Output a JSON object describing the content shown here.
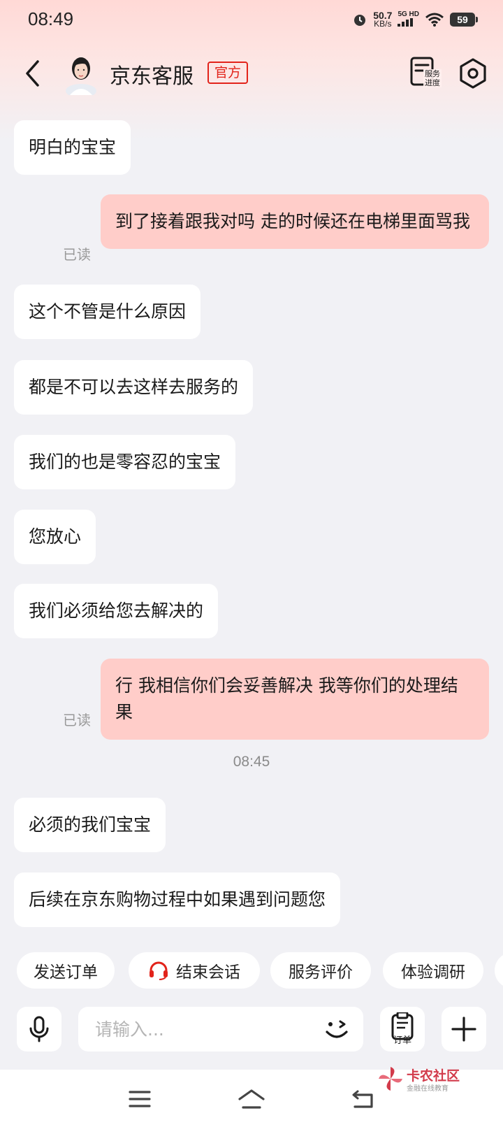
{
  "status_bar": {
    "time": "08:49",
    "net_speed_value": "50.7",
    "net_speed_unit": "KB/s",
    "network_type": "5G HD",
    "battery": "59"
  },
  "header": {
    "title": "京东客服",
    "badge": "官方",
    "service_progress_label": "服务进度"
  },
  "messages": [
    {
      "side": "left",
      "text": "明白的宝宝"
    },
    {
      "side": "right",
      "text": "到了接着跟我对吗 走的时候还在电梯里面骂我",
      "status": "已读"
    },
    {
      "side": "left",
      "text": "这个不管是什么原因"
    },
    {
      "side": "left",
      "text": "都是不可以去这样去服务的"
    },
    {
      "side": "left",
      "text": "我们的也是零容忍的宝宝"
    },
    {
      "side": "left",
      "text": "您放心"
    },
    {
      "side": "left",
      "text": "我们必须给您去解决的"
    },
    {
      "side": "right",
      "text": "行 我相信你们会妥善解决 我等你们的处理结果",
      "status": "已读"
    },
    {
      "side": "time",
      "text": "08:45"
    },
    {
      "side": "left",
      "text": "必须的我们宝宝"
    },
    {
      "side": "left",
      "text": "后续在京东购物过程中如果遇到问题您"
    }
  ],
  "quick_actions": [
    {
      "label": "发送订单",
      "icon": null
    },
    {
      "label": "结束会话",
      "icon": "headset-icon"
    },
    {
      "label": "服务评价",
      "icon": null
    },
    {
      "label": "体验调研",
      "icon": null
    }
  ],
  "input": {
    "placeholder": "请输入...",
    "order_label": "订单"
  },
  "watermark": {
    "title": "卡农社区",
    "subtitle": "金融在线教育"
  },
  "colors": {
    "accent_red": "#e2231a",
    "user_bubble": "#ffcdc9",
    "background": "#f1f1f5"
  }
}
